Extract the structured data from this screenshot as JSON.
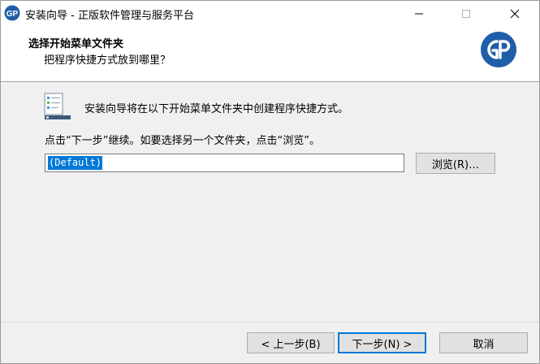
{
  "window": {
    "title": "安装向导 - 正版软件管理与服务平台"
  },
  "header": {
    "title": "选择开始菜单文件夹",
    "subtitle": "把程序快捷方式放到哪里？"
  },
  "main": {
    "intro": "安装向导将在以下开始菜单文件夹中创建程序快捷方式。",
    "instruction": "点击“下一步”继续。如要选择另一个文件夹，点击“浏览”。",
    "folder_value": "(Default)",
    "browse_label": "浏览(R)…"
  },
  "footer": {
    "back_label": "< 上一步(B)",
    "next_label": "下一步(N) >",
    "cancel_label": "取消"
  },
  "colors": {
    "brand": "#1f5ea8",
    "selection": "#0078d7"
  },
  "icons": {
    "app": "gp-logo-icon",
    "header": "gp-logo-icon",
    "folder": "start-menu-folder-icon"
  }
}
